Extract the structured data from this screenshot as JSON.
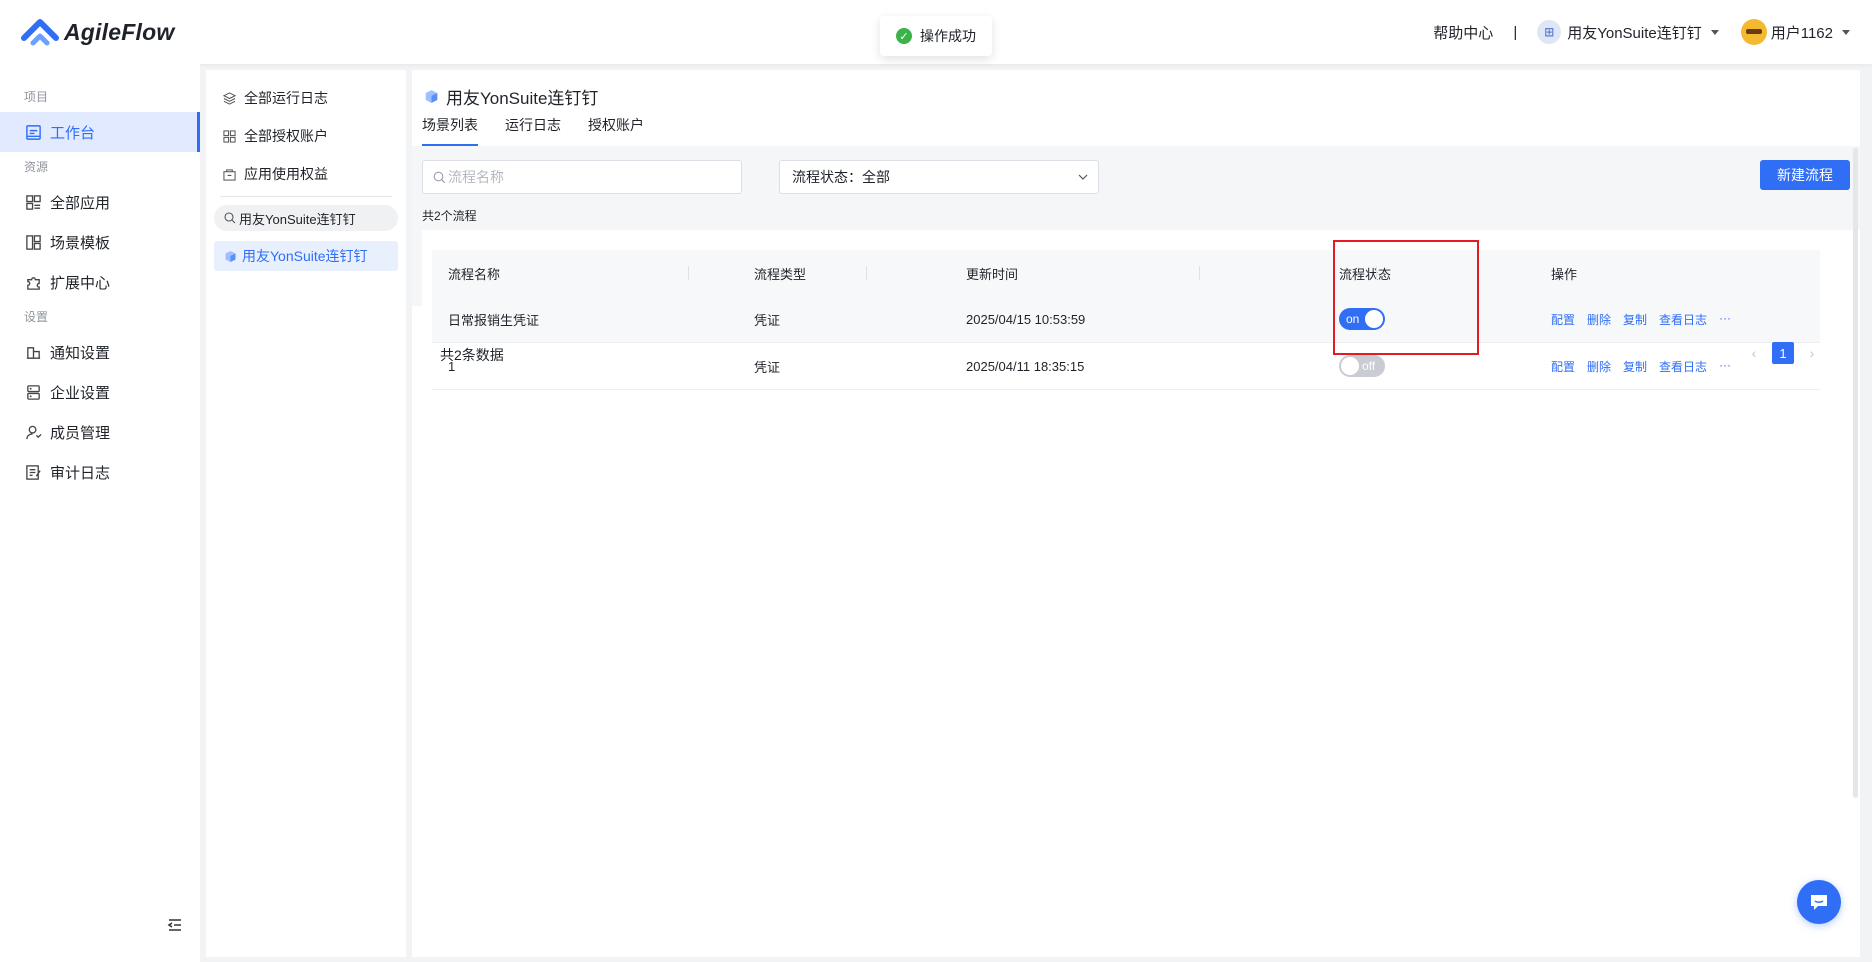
{
  "header": {
    "logo_text": "AgileFlow",
    "help_label": "帮助中心",
    "separator": "|",
    "tenant_icon_text": "⊞",
    "tenant_name": "用友YonSuite连钉钉",
    "user_name": "用户1162"
  },
  "toast": {
    "icon": "✓",
    "message": "操作成功"
  },
  "sidebar": {
    "group_project": "项目",
    "workbench": "工作台",
    "group_resources": "资源",
    "all_apps": "全部应用",
    "scene_templates": "场景模板",
    "extension_center": "扩展中心",
    "group_settings": "设置",
    "notification_settings": "通知设置",
    "enterprise_settings": "企业设置",
    "member_management": "成员管理",
    "audit_log": "审计日志"
  },
  "panel2": {
    "all_run_logs": "全部运行日志",
    "all_auth_accounts": "全部授权账户",
    "app_usage_rights": "应用使用权益",
    "search_value": "用友YonSuite连钉钉",
    "app_item": "用友YonSuite连钉钉"
  },
  "main": {
    "title": "用友YonSuite连钉钉",
    "tabs": [
      "场景列表",
      "运行日志",
      "授权账户"
    ],
    "search_placeholder": "流程名称",
    "status_filter": "流程状态：全部",
    "new_button": "新建流程",
    "total_flows": "共2个流程",
    "columns": [
      "流程名称",
      "流程类型",
      "更新时间",
      "流程状态",
      "操作"
    ],
    "rows": [
      {
        "name": "日常报销生凭证",
        "type": "凭证",
        "updated": "2025/04/15 10:53:59",
        "status": "on"
      },
      {
        "name": "1",
        "type": "凭证",
        "updated": "2025/04/11 18:35:15",
        "status": "off"
      }
    ],
    "ops": [
      "配置",
      "删除",
      "复制",
      "查看日志",
      "···"
    ],
    "total_rows": "共2条数据",
    "pagination": {
      "prev": "‹",
      "current": "1",
      "next": "›"
    }
  },
  "colors": {
    "primary": "#2f6ef5",
    "success": "#3cb34a",
    "highlight": "#e31b23"
  }
}
